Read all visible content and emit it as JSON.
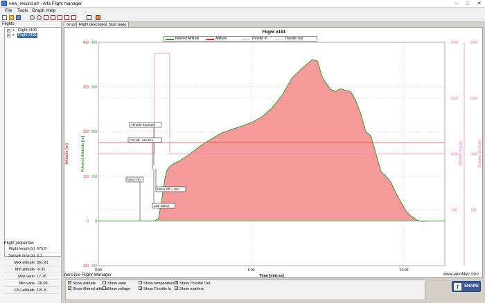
{
  "window": {
    "title": "new_record.afr - Alfa Flight manager",
    "min_glyph": "–",
    "max_glyph": "□",
    "close_glyph": "✕"
  },
  "menu": {
    "items": [
      "File",
      "Tools",
      "Graph",
      "Help"
    ]
  },
  "toolbar": {
    "icons": [
      "new-file-icon",
      "open-folder-icon",
      "save-icon",
      "separator",
      "zoom-in-icon",
      "zoom-out-icon",
      "export-1-icon",
      "export-2-icon",
      "export-3-icon",
      "export-4-icon",
      "export-5-icon",
      "close-icon",
      "edit-icon"
    ]
  },
  "sidebar": {
    "flights_label": "Flights",
    "flights": [
      {
        "label": "Flight #190",
        "selected": false
      },
      {
        "label": "Flight #191",
        "selected": true
      }
    ],
    "properties_label": "Flight properties",
    "properties": [
      {
        "name": "Flight length [s]",
        "value": "679.9"
      },
      {
        "name": "Sample time [s]",
        "value": "0.1"
      },
      {
        "name": "Max altitude",
        "value": "361.61"
      },
      {
        "name": "Min altitude",
        "value": "-0.91"
      },
      {
        "name": "Max vario",
        "value": "17.76"
      },
      {
        "name": "Min vario",
        "value": "-26.09"
      },
      {
        "name": "FSJ altitude",
        "value": "121.8"
      }
    ]
  },
  "tabs": [
    "Graph",
    "Flight description",
    "Start page"
  ],
  "chart": {
    "title": "Flight #191",
    "legend": [
      "Filtered Altitude",
      "Altitude",
      "Throttle In",
      "Throttle Out"
    ],
    "left_axis_label": "Altitude [m]",
    "left_axis2_label": "Filtered Altitude [m]",
    "right_axis_label": "Throttle In [us]",
    "right_axis2_label": "Throttle Out [us]",
    "x_axis_label": "Time [mm:ss]",
    "annotations": [
      "Throttle Rearmed",
      "FSJ alt.: 121.8 m",
      "Motor On",
      "Motor Off + 10s",
      "Line switch"
    ],
    "footer_left": "AeroTec Flight Manager",
    "footer_right": "www.aerobtec.com"
  },
  "chart_data": {
    "type": "area",
    "title": "Flight #191",
    "xlabel": "Time [mm:ss]",
    "ylabel": "Altitude [m]",
    "x_ticks": [
      "0:00",
      "5:00",
      "10:00"
    ],
    "x_tick_values": [
      0,
      300,
      600
    ],
    "xlim": [
      0,
      680
    ],
    "ylim": [
      -100,
      400
    ],
    "y_ticks": [
      -100,
      0,
      100,
      200,
      300,
      400
    ],
    "y2_ticks": [
      500,
      1000,
      1500,
      2000
    ],
    "y2lim": [
      0,
      2000
    ],
    "grid": true,
    "series": [
      {
        "name": "Filtered Altitude",
        "color": "#2e9c2e",
        "fill": "#f59a9a",
        "x": [
          0,
          60,
          110,
          118,
          124,
          130,
          134,
          140,
          148,
          160,
          180,
          200,
          220,
          240,
          260,
          280,
          300,
          320,
          340,
          360,
          380,
          400,
          420,
          430,
          440,
          455,
          465,
          475,
          485,
          495,
          505,
          515,
          525,
          535,
          545,
          555,
          565,
          575,
          585,
          595,
          605,
          615,
          625,
          635,
          650,
          665,
          680
        ],
        "values": [
          0,
          0,
          0,
          5,
          45,
          90,
          112,
          122,
          128,
          135,
          150,
          168,
          182,
          196,
          204,
          212,
          220,
          232,
          252,
          280,
          320,
          342,
          361,
          358,
          320,
          295,
          290,
          296,
          292,
          290,
          270,
          240,
          200,
          190,
          150,
          110,
          100,
          85,
          60,
          40,
          20,
          10,
          2,
          -1,
          0,
          0,
          0
        ]
      },
      {
        "name": "Altitude",
        "color": "#e03030",
        "x": [
          0,
          680
        ],
        "values": [
          175,
          175
        ]
      },
      {
        "name": "Throttle In",
        "color": "#ff80c0",
        "x": [
          0,
          110,
          110,
          140,
          140,
          680
        ],
        "values": [
          1000,
          1000,
          1900,
          1900,
          1000,
          1000
        ]
      }
    ]
  },
  "checkboxes": [
    {
      "label": "Show altitude",
      "checked": true
    },
    {
      "label": "Show filtered altitude",
      "checked": true
    },
    {
      "label": "Show vario",
      "checked": false
    },
    {
      "label": "Show voltage",
      "checked": false
    },
    {
      "label": "Show temperature",
      "checked": false
    },
    {
      "label": "Show Throttle In",
      "checked": true
    },
    {
      "label": "Show Throttle Out",
      "checked": true
    },
    {
      "label": "Show markers",
      "checked": true
    }
  ],
  "share": {
    "label": "SHARE",
    "icon": "facebook-icon",
    "glyph": "f"
  },
  "colors": {
    "left_axis": "#e03030",
    "left_axis2": "#2e9c2e",
    "right_axis": "#ff60b0",
    "fill": "#f59a9a",
    "selection": "#3a6ea5",
    "facebook": "#3b5998"
  }
}
